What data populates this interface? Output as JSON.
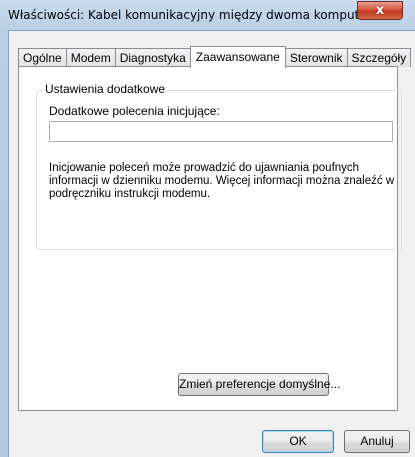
{
  "window": {
    "title": "Właściwości: Kabel komunikacyjny między dwoma komputerami",
    "close_label": "x"
  },
  "tabs": [
    {
      "label": "Ogólne",
      "active": false
    },
    {
      "label": "Modem",
      "active": false
    },
    {
      "label": "Diagnostyka",
      "active": false
    },
    {
      "label": "Zaawansowane",
      "active": true
    },
    {
      "label": "Sterownik",
      "active": false
    },
    {
      "label": "Szczegóły",
      "active": false
    }
  ],
  "advanced": {
    "group_title": "Ustawienia dodatkowe",
    "init_commands_label": "Dodatkowe polecenia inicjujące:",
    "init_commands_value": "",
    "info_text": "Inicjowanie poleceń może prowadzić do ujawniania poufnych informacji w dzienniku modemu. Więcej informacji można znaleźć w podręczniku instrukcji modemu.",
    "defaults_button": "Zmień preferencje domyślne..."
  },
  "footer": {
    "ok_label": "OK",
    "cancel_label": "Anuluj"
  }
}
